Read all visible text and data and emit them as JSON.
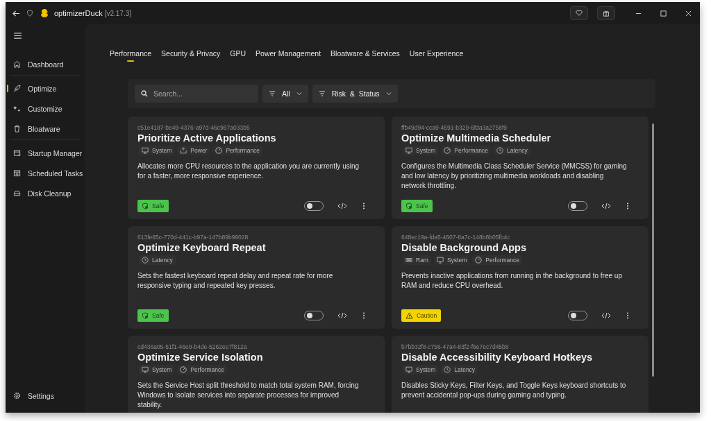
{
  "window": {
    "app_name": "optimizerDuck",
    "version": "[v2.17.3]"
  },
  "sidebar": {
    "items": [
      {
        "label": "Dashboard",
        "selected": false
      },
      {
        "label": "Optimize",
        "selected": true
      },
      {
        "label": "Customize",
        "selected": false
      },
      {
        "label": "Bloatware",
        "selected": false
      },
      {
        "label": "Startup Manager",
        "selected": false
      },
      {
        "label": "Scheduled Tasks",
        "selected": false
      },
      {
        "label": "Disk Cleanup",
        "selected": false
      }
    ],
    "footer": {
      "label": "Settings"
    }
  },
  "tabs": [
    {
      "label": "Performance",
      "selected": true
    },
    {
      "label": "Security & Privacy",
      "selected": false
    },
    {
      "label": "GPU",
      "selected": false
    },
    {
      "label": "Power Management",
      "selected": false
    },
    {
      "label": "Bloatware & Services",
      "selected": false
    },
    {
      "label": "User Experience",
      "selected": false
    }
  ],
  "search": {
    "placeholder": "Search..."
  },
  "filters": [
    {
      "label": "All"
    },
    {
      "label": "Risk  &  Status"
    }
  ],
  "cards": [
    {
      "id": "c51e4187-be49-4376-a97d-46c967a033b5",
      "title": "Prioritize Active Applications",
      "tags": [
        {
          "kind": "system",
          "label": "System"
        },
        {
          "kind": "power",
          "label": "Power"
        },
        {
          "kind": "performance",
          "label": "Performance"
        }
      ],
      "description": "Allocates more CPU resources to the application you are currently using for a faster, more responsive experience.",
      "risk": {
        "kind": "safe",
        "label": "Safe"
      },
      "on": false
    },
    {
      "id": "ffb49d94-cca9-4591-b329-6fda3a2758f9",
      "title": "Optimize Multimedia Scheduler",
      "tags": [
        {
          "kind": "system",
          "label": "System"
        },
        {
          "kind": "performance",
          "label": "Performance"
        },
        {
          "kind": "latency",
          "label": "Latency"
        }
      ],
      "description": "Configures the Multimedia Class Scheduler Service (MMCSS) for gaming and low latency by prioritizing multimedia workloads and disabling network throttling.",
      "risk": {
        "kind": "safe",
        "label": "Safe"
      },
      "on": false
    },
    {
      "id": "613fe85c-770d-441c-b97a-147b89b99028",
      "title": "Optimize Keyboard Repeat",
      "tags": [
        {
          "kind": "latency",
          "label": "Latency"
        }
      ],
      "description": "Sets the fastest keyboard repeat delay and repeat rate for more responsive typing and repeated key presses.",
      "risk": {
        "kind": "safe",
        "label": "Safe"
      },
      "on": false
    },
    {
      "id": "648ec19a-fda5-4607-8a7c-148b8b05fb4c",
      "title": "Disable Background Apps",
      "tags": [
        {
          "kind": "ram",
          "label": "Ram"
        },
        {
          "kind": "system",
          "label": "System"
        },
        {
          "kind": "performance",
          "label": "Performance"
        }
      ],
      "description": "Prevents inactive applications from running in the background to free up RAM and reduce CPU overhead.",
      "risk": {
        "kind": "caution",
        "label": "Caution"
      },
      "on": false
    },
    {
      "id": "cd436a05-51f1-46e9-b4de-5262ee7f812a",
      "title": "Optimize Service Isolation",
      "tags": [
        {
          "kind": "system",
          "label": "System"
        },
        {
          "kind": "performance",
          "label": "Performance"
        }
      ],
      "description": "Sets the Service Host split threshold to match total system RAM, forcing Windows to isolate services into separate processes for improved stability."
    },
    {
      "id": "b7bb32f8-c756-47a4-83f2-f6e7ec7d45b8",
      "title": "Disable Accessibility Keyboard Hotkeys",
      "tags": [
        {
          "kind": "system",
          "label": "System"
        },
        {
          "kind": "latency",
          "label": "Latency"
        }
      ],
      "description": "Disables Sticky Keys, Filter Keys, and Toggle Keys keyboard shortcuts to prevent accidental pop-ups during gaming and typing."
    }
  ]
}
